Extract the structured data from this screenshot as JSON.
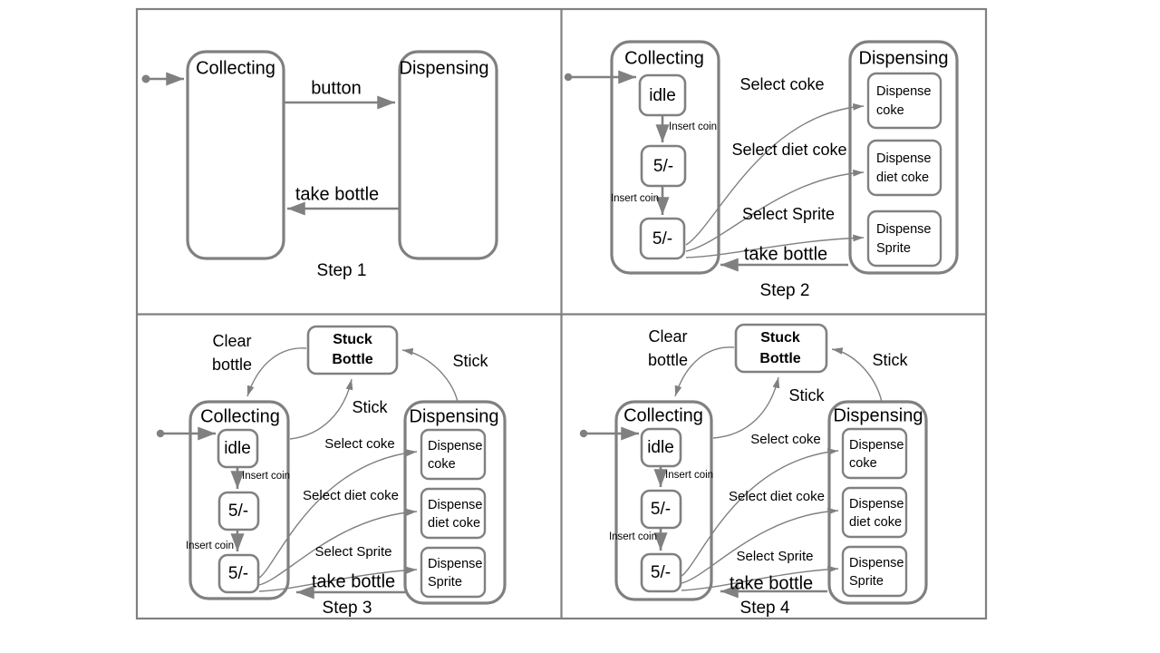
{
  "figure": {
    "title": "Vending machine statechart refinement steps",
    "panels": [
      {
        "id": "step1",
        "caption": "Step 1",
        "regions": [
          {
            "name": "Collecting"
          },
          {
            "name": "Dispensing"
          }
        ],
        "transitions": [
          {
            "label": "button",
            "from": "Collecting",
            "to": "Dispensing"
          },
          {
            "label": "take bottle",
            "from": "Dispensing",
            "to": "Collecting"
          }
        ]
      },
      {
        "id": "step2",
        "caption": "Step 2",
        "regions": [
          {
            "name": "Collecting",
            "states": [
              "idle",
              "5/-",
              "5/-"
            ]
          },
          {
            "name": "Dispensing",
            "states": [
              "Dispense coke",
              "Dispense diet coke",
              "Dispense Sprite"
            ]
          }
        ],
        "transitions": [
          {
            "label": "Insert coin",
            "from": "idle",
            "to": "5/-"
          },
          {
            "label": "Insert coin",
            "from": "5/-",
            "to": "5/-"
          },
          {
            "label": "Select coke",
            "from": "5/-",
            "to": "Dispense coke"
          },
          {
            "label": "Select diet coke",
            "from": "5/-",
            "to": "Dispense diet coke"
          },
          {
            "label": "Select Sprite",
            "from": "5/-",
            "to": "Dispense Sprite"
          },
          {
            "label": "take bottle",
            "from": "Dispensing",
            "to": "Collecting"
          }
        ]
      },
      {
        "id": "step3",
        "caption": "Step 3",
        "regions": [
          {
            "name": "Collecting",
            "states": [
              "idle",
              "5/-",
              "5/-"
            ]
          },
          {
            "name": "Dispensing",
            "states": [
              "Dispense coke",
              "Dispense diet coke",
              "Dispense Sprite"
            ]
          },
          {
            "name": "Stuck Bottle"
          }
        ],
        "transitions": [
          {
            "label": "Insert coin",
            "from": "idle",
            "to": "5/-"
          },
          {
            "label": "Insert coin",
            "from": "5/-",
            "to": "5/-"
          },
          {
            "label": "Select coke",
            "from": "5/-",
            "to": "Dispense coke"
          },
          {
            "label": "Select diet coke",
            "from": "5/-",
            "to": "Dispense diet coke"
          },
          {
            "label": "Select Sprite",
            "from": "5/-",
            "to": "Dispense Sprite"
          },
          {
            "label": "take bottle",
            "from": "Dispensing",
            "to": "Collecting"
          },
          {
            "label": "Clear bottle",
            "from": "Stuck Bottle",
            "to": "Collecting"
          },
          {
            "label": "Stick",
            "from": "Collecting",
            "to": "Stuck Bottle"
          },
          {
            "label": "Stick",
            "from": "Dispensing",
            "to": "Stuck Bottle"
          }
        ]
      },
      {
        "id": "step4",
        "caption": "Step 4",
        "regions": [
          {
            "name": "Collecting",
            "states": [
              "idle",
              "5/-",
              "5/-"
            ]
          },
          {
            "name": "Dispensing",
            "states": [
              "Dispense coke",
              "Dispense diet coke",
              "Dispense Sprite"
            ]
          },
          {
            "name": "Stuck Bottle"
          }
        ],
        "transitions": [
          {
            "label": "Insert coin",
            "from": "idle",
            "to": "5/-"
          },
          {
            "label": "Insert coin",
            "from": "5/-",
            "to": "5/-"
          },
          {
            "label": "Select coke",
            "from": "5/-",
            "to": "Dispense coke"
          },
          {
            "label": "Select diet coke",
            "from": "5/-",
            "to": "Dispense diet coke"
          },
          {
            "label": "Select Sprite",
            "from": "5/-",
            "to": "Dispense Sprite"
          },
          {
            "label": "take bottle",
            "from": "Dispensing",
            "to": "Collecting"
          },
          {
            "label": "Clear bottle",
            "from": "Stuck Bottle",
            "to": "Collecting"
          },
          {
            "label": "Stick",
            "from": "Collecting",
            "to": "Stuck Bottle"
          },
          {
            "label": "Stick",
            "from": "Dispensing",
            "to": "Stuck Bottle"
          }
        ]
      }
    ]
  },
  "labels": {
    "collecting": "Collecting",
    "dispensing": "Dispensing",
    "stuck_line1": "Stuck",
    "stuck_line2": "Bottle",
    "idle": "idle",
    "coin5": "5/-",
    "dispense": "Dispense",
    "coke": "coke",
    "diet_coke": "diet coke",
    "sprite": "Sprite",
    "button": "button",
    "take_bottle": "take bottle",
    "insert_coin": "Insert coin",
    "select_coke": "Select coke",
    "select_diet_coke": "Select diet coke",
    "select_sprite": "Select Sprite",
    "clear_line1": "Clear",
    "clear_line2": "bottle",
    "stick": "Stick",
    "step1": "Step 1",
    "step2": "Step 2",
    "step3": "Step 3",
    "step4": "Step 4"
  },
  "colors": {
    "stroke": "#808080",
    "text": "#000000",
    "background": "#ffffff"
  }
}
